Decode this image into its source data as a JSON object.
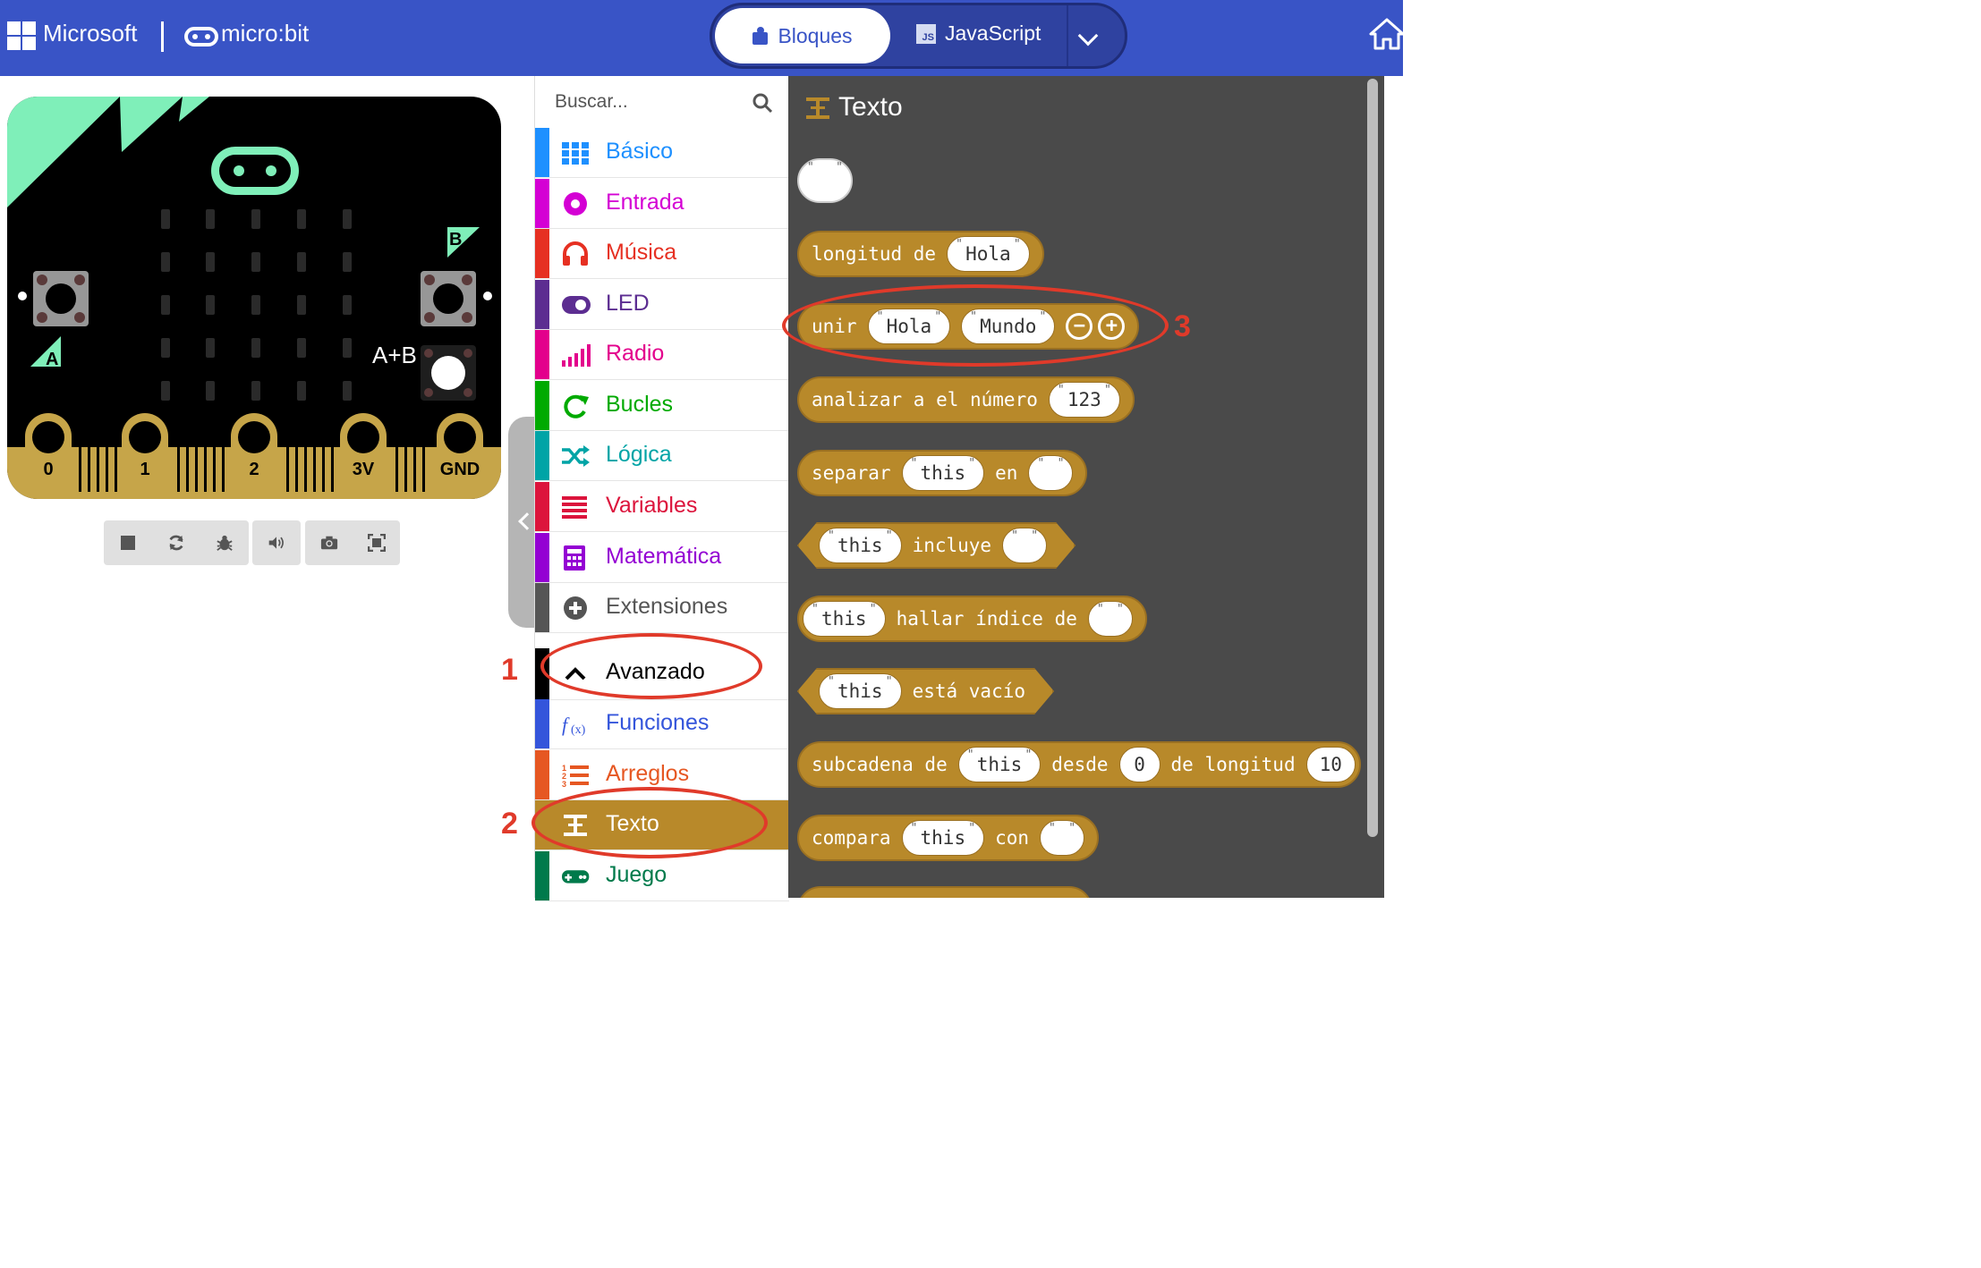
{
  "header": {
    "brand": "Microsoft",
    "product": "micro:bit",
    "mode_blocks": "Bloques",
    "mode_js": "JavaScript",
    "mode_js_icon_text": "JS",
    "colors": {
      "bar": "#3954c6",
      "toggle": "#2f42a0"
    }
  },
  "simulator": {
    "button_a": "A",
    "button_b": "B",
    "button_ab": "A+B",
    "pins": [
      "0",
      "1",
      "2",
      "3V",
      "GND"
    ],
    "toolbar_icons": [
      "stop-icon",
      "restart-icon",
      "debug-icon",
      "sound-icon",
      "screenshot-icon",
      "fullscreen-icon"
    ]
  },
  "toolbox": {
    "search_placeholder": "Buscar...",
    "categories": [
      {
        "label": "Básico",
        "color": "#1e90ff",
        "icon": "grid-icon"
      },
      {
        "label": "Entrada",
        "color": "#d400d4",
        "icon": "input-icon"
      },
      {
        "label": "Música",
        "color": "#e63022",
        "icon": "headphones-icon"
      },
      {
        "label": "LED",
        "color": "#5c2d91",
        "icon": "toggle-icon"
      },
      {
        "label": "Radio",
        "color": "#e3008c",
        "icon": "signal-icon"
      },
      {
        "label": "Bucles",
        "color": "#00aa00",
        "icon": "loop-icon"
      },
      {
        "label": "Lógica",
        "color": "#00a4a6",
        "icon": "shuffle-icon"
      },
      {
        "label": "Variables",
        "color": "#dc143c",
        "icon": "lines-icon"
      },
      {
        "label": "Matemática",
        "color": "#9400d3",
        "icon": "calculator-icon"
      },
      {
        "label": "Extensiones",
        "color": "#555555",
        "icon": "plus-circle-icon"
      },
      {
        "label": "Avanzado",
        "color": "#000000",
        "icon": "chevron-up-icon"
      },
      {
        "label": "Funciones",
        "color": "#3455db",
        "icon": "function-icon"
      },
      {
        "label": "Arreglos",
        "color": "#e65722",
        "icon": "list-icon"
      },
      {
        "label": "Texto",
        "color": "#b8860b",
        "icon": "text-icon"
      },
      {
        "label": "Juego",
        "color": "#007a4b",
        "icon": "gamepad-icon"
      }
    ]
  },
  "flyout": {
    "title": "Texto",
    "blocks": {
      "empty": "",
      "length_label": "longitud de",
      "length_value": "Hola",
      "join_label": "unir",
      "join_value1": "Hola",
      "join_value2": "Mundo",
      "join_minus": "−",
      "join_plus": "+",
      "parse_label": "analizar a el número",
      "parse_value": "123",
      "split_label": "separar",
      "split_value": "this",
      "split_en": "en",
      "includes_value": "this",
      "includes_label": "incluye",
      "index_value": "this",
      "index_label": "hallar índice de",
      "empty_value": "this",
      "empty_label": "está vacío",
      "substr_label": "subcadena de",
      "substr_value": "this",
      "substr_from": "desde",
      "substr_from_value": "0",
      "substr_len": "de longitud",
      "substr_len_value": "10",
      "compare_label": "compara",
      "compare_value": "this",
      "compare_con": "con"
    }
  },
  "annotations": {
    "n1": "1",
    "n2": "2",
    "n3": "3",
    "color": "#e03a2a"
  }
}
